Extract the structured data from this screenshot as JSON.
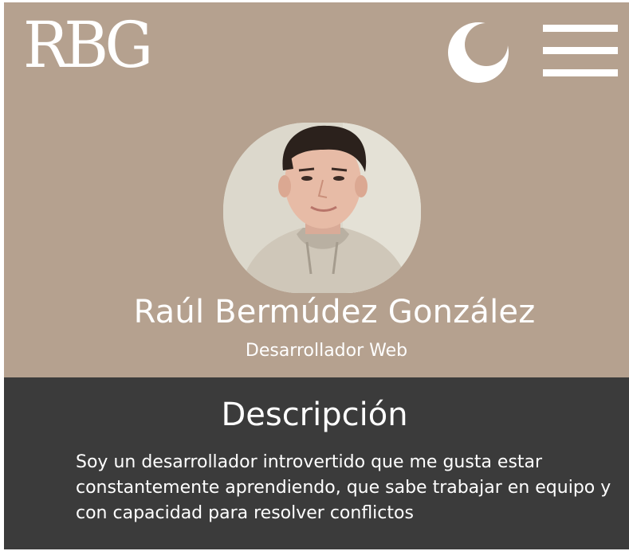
{
  "header": {
    "logo_text": "RBG",
    "theme_toggle_icon": "moon-icon",
    "menu_icon": "hamburger-menu-icon",
    "background_color": "#b5a18f"
  },
  "profile": {
    "photo_alt": "Foto de Raúl Bermúdez González",
    "name": "Raúl Bermúdez González",
    "role": "Desarrollador Web"
  },
  "description": {
    "title": "Descripción",
    "text": "Soy un desarrollador introvertido que me gusta estar constantemente aprendiendo, que sabe trabajar en equipo y con capacidad para resolver conflictos",
    "background_color": "#3b3b3b"
  }
}
